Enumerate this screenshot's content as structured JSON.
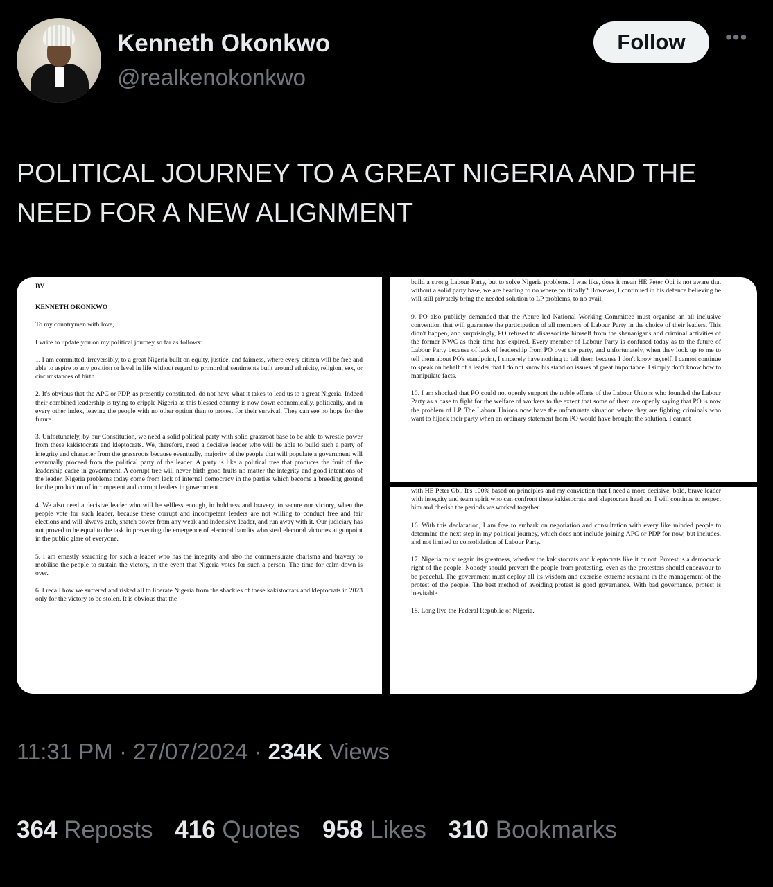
{
  "author": {
    "name": "Kenneth Okonkwo",
    "handle": "@realkenokonkwo",
    "follow_label": "Follow",
    "more_icon": "more-icon"
  },
  "tweet": {
    "text": "POLITICAL JOURNEY TO A GREAT NIGERIA AND THE NEED FOR A NEW ALIGNMENT"
  },
  "document": {
    "left": {
      "by": "BY",
      "author": "KENNETH OKONKWO",
      "salutation": "To my countrymen with love,",
      "intro": "I write to update you on my political journey so far as follows:",
      "p1": "1.   I am committed, irreversibly, to a great Nigeria built on equity, justice, and fairness, where every citizen will be free and able to aspire to any position or level in life without regard to primordial sentiments built around ethnicity, religion, sex, or circumstances of birth.",
      "p2": "2.   It's obvious that the APC or PDP, as presently constituted, do not have what it takes to lead us to a great Nigeria. Indeed their combined leadership is trying to cripple Nigeria as this blessed country is now down economically, politically, and in every other index, leaving the people with no other option than to protest for their survival. They can see no hope for the future.",
      "p3": "3.   Unfortunately, by our Constitution, we need a solid political party with solid grassroot base to be able to wrestle power from these kakistocrats and kleptocrats. We, therefore, need a decisive leader who will be able to build such a party of integrity and character from the grassroots because eventually, majority of the people that will populate a government will eventually proceed from the political party of the leader. A party is like a political tree that produces the fruit of the leadership cadre in government. A corrupt tree will never birth good fruits no matter the integrity and good intentions of the leader. Nigeria problems today come from lack of internal democracy in the parties which become a breeding ground for the production of incompetent and corrupt leaders in government.",
      "p4": "4.   We also need a decisive leader who will be selfless enough, in boldness and bravery, to secure our victory, when the people vote for such leader, because these corrupt and incompetent leaders are not willing to conduct free and fair elections and will always grab, snatch power from any weak and indecisive leader, and run away with it. Our judiciary has not proved to be equal to the task in preventing the emergence of electoral bandits who steal electoral victories at gunpoint in the public glare of everyone.",
      "p5": "5.   I am ernestly searching for such a leader who has the integrity and also the commensurate charisma and bravery to mobilise the people to sustain the victory, in the event that Nigeria votes for such a person. The time for calm down is over.",
      "p6": "6.   I recall how we suffered and risked all to liberate Nigeria from the shackles of these kakistocrats and kleptocrats in 2023 only for the victory to be stolen. It is obvious that the"
    },
    "right_top": {
      "p8_tail": "build a strong Labour Party, but to solve Nigeria problems. I was like, does it mean HE Peter Obi is not aware that without a solid party base, we are heading to no where politically? However, I continued in his defence believing he will still privately bring the needed solution to LP problems, to no avail.",
      "p9": "9.   PO also publicly demanded that the Abure led National Working Committee must organise an all inclusive convention that will guarantee the participation of all members of Labour Party in the choice of their leaders. This didn't happen, and surprisingly, PO refused to disassociate himself from the shenanigans and criminal activities of the former NWC as their time has expired. Every member of Labour Party is confused today as to the future of Labour Party because of lack of leadership from PO over the party, and unfortunately, when they look up to me to tell them about PO's standpoint, I sincerely have nothing to tell them because I don't know myself. I cannot continue to speak on behalf of a leader that I do not know his stand on issues of great importance. I simply don't know how to manipulate facts.",
      "p10": "10.   I am shocked that PO could not openly support the noble efforts of the Labour Unions who founded the Labour Party as a base to fight for the welfare of workers to the extent that some of them are openly saying that PO is now the problem of LP. The Labour Unions now have the unfortunate situation where they are fighting criminals who want to hijack their party when an ordinary statement from PO would have brought the solution. I cannot"
    },
    "right_bottom": {
      "p15_tail": "with HE Peter Obi. It's 100% based on principles and my conviction that I need a more decisive, bold, brave leader with integrity and team spirit who can confront these kakistocrats and kleptocrats head on. I will continue to respect him and cherish the periods we worked together.",
      "p16": "16.   With this declaration, I am free to embark on negotiation and consultation with every like minded people to determine the next step in my political journey, which does not include joining APC or PDP for now, but includes, and not limited to consolidation of Labour Party.",
      "p17": "17.   Nigeria must regain its greatness, whether the kakistocrats and kleptocrats like it or not. Protest is a democratic right of the people. Nobody should prevent the people from protesting, even as the protesters should endeavour to be peaceful. The government must deploy all its wisdom and exercise extreme restraint in the management of the protest of the people. The best method of avoiding protest is good governance. With bad governance, protest is inevitable.",
      "p18": "18.   Long live the Federal Republic of Nigeria."
    }
  },
  "meta": {
    "time": "11:31 PM",
    "date": "27/07/2024",
    "views_count": "234K",
    "views_label": "Views",
    "separator": "·"
  },
  "stats": {
    "reposts_count": "364",
    "reposts_label": "Reposts",
    "quotes_count": "416",
    "quotes_label": "Quotes",
    "likes_count": "958",
    "likes_label": "Likes",
    "bookmarks_count": "310",
    "bookmarks_label": "Bookmarks"
  },
  "colors": {
    "background": "#000000",
    "text_primary": "#e7e9ea",
    "text_secondary": "#71767b",
    "follow_bg": "#eff3f4",
    "divider": "#2f3336"
  }
}
